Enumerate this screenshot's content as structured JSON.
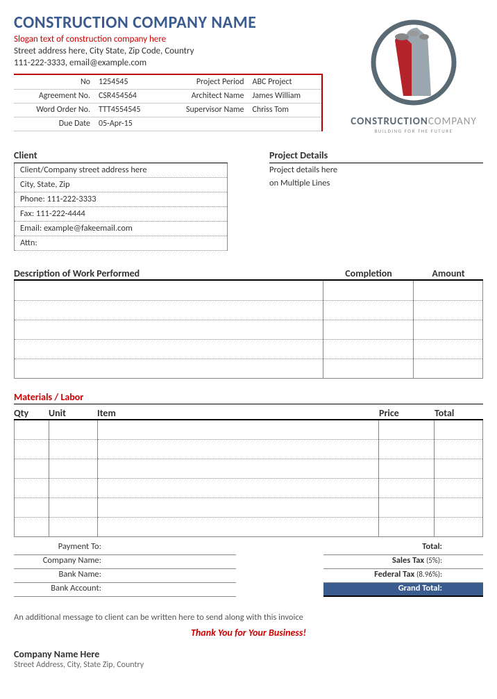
{
  "header": {
    "company_name": "CONSTRUCTION COMPANY NAME",
    "slogan": "Slogan text of construction company here",
    "address": "Street address here, City State, Zip Code, Country",
    "contact": "111-222-3333, email@example.com",
    "logo_brand_bold": "CONSTRUCTION",
    "logo_brand_light": "COMPANY",
    "logo_tag": "BUILDING FOR THE FUTURE"
  },
  "meta": {
    "no_lbl": "No",
    "no_val": "1254545",
    "period_lbl": "Project Period",
    "period_val": "ABC Project",
    "agree_lbl": "Agreement No.",
    "agree_val": "CSR454564",
    "arch_lbl": "Architect Name",
    "arch_val": "James William",
    "word_lbl": "Word Order No.",
    "word_val": "TTT4554545",
    "sup_lbl": "Supervisor Name",
    "sup_val": "Chriss Tom",
    "due_lbl": "Due Date",
    "due_val": "05-Apr-15"
  },
  "client": {
    "title": "Client",
    "lines": [
      "Client/Company street address here",
      "City, State, Zip",
      "Phone: 111-222-3333",
      "Fax: 111-222-4444",
      "Email: example@fakeemail.com",
      "Attn:"
    ]
  },
  "project": {
    "title": "Project Details",
    "line1": "Project details here",
    "line2": "on Multiple Lines"
  },
  "work": {
    "h1": "Description of Work Performed",
    "h2": "Completion",
    "h3": "Amount"
  },
  "materials": {
    "title": "Materials / Labor",
    "q": "Qty",
    "u": "Unit",
    "i": "Item",
    "p": "Price",
    "t": "Total"
  },
  "payment": {
    "to": "Payment To:",
    "co": "Company Name:",
    "bank": "Bank Name:",
    "acct": "Bank Account:"
  },
  "totals": {
    "total": "Total:",
    "sales_lbl": "Sales Tax",
    "sales_pct": "(5%):",
    "fed_lbl": "Federal Tax",
    "fed_pct": "(8.96%):",
    "grand": "Grand Total:"
  },
  "footer": {
    "msg": "An additional message to client can be written here to send along with this invoice",
    "thanks": "Thank You for Your Business!",
    "co": "Company Name Here",
    "addr": "Street Address, City, State Zip, Country"
  }
}
